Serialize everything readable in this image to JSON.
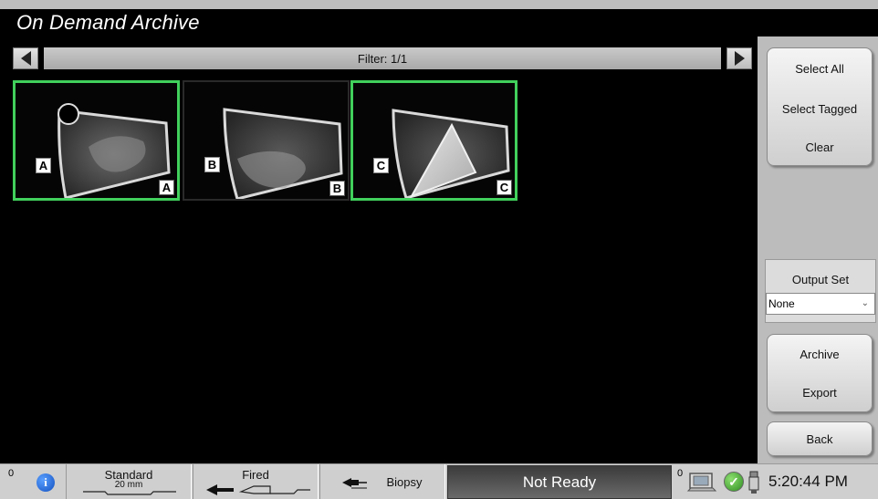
{
  "app": {
    "title": "On Demand Archive"
  },
  "filter": {
    "label": "Filter: 1/1"
  },
  "thumbnails": [
    {
      "letter": "A",
      "selected": true
    },
    {
      "letter": "B",
      "selected": false
    },
    {
      "letter": "C",
      "selected": true
    }
  ],
  "sidebar": {
    "select_all": "Select All",
    "select_tagged": "Select Tagged",
    "clear": "Clear",
    "output_set_label": "Output Set",
    "output_set_value": "None",
    "archive": "Archive",
    "export": "Export",
    "back": "Back"
  },
  "status": {
    "left_count": "0",
    "paddle_name": "Standard",
    "paddle_size": "20 mm",
    "fired": "Fired",
    "biopsy": "Biopsy",
    "not_ready": "Not Ready",
    "right_count": "0",
    "time": "5:20:44 PM"
  },
  "colors": {
    "selection": "#41d05c",
    "background": "#000000",
    "panel": "#bcbcbc"
  },
  "icons": [
    "info-icon",
    "arrow-left-icon",
    "needle-icon",
    "computer-icon",
    "check-icon",
    "tube-icon"
  ]
}
